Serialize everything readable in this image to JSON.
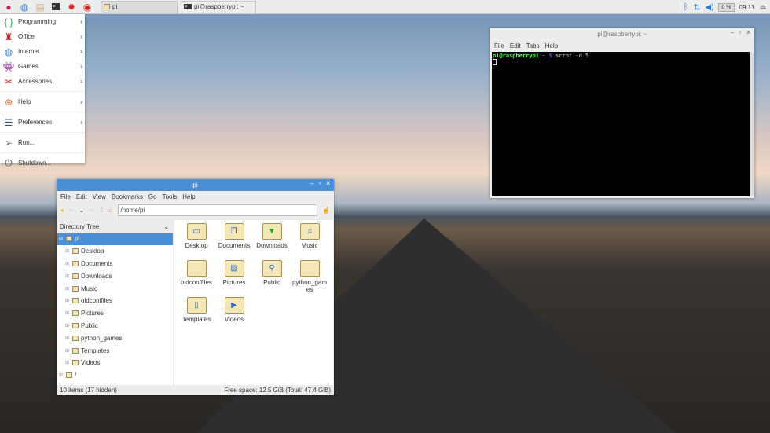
{
  "taskbar": {
    "launchers": [
      "raspberry-icon",
      "globe-icon",
      "folders-icon",
      "terminal-icon",
      "mathematica-icon",
      "wolfram-icon"
    ],
    "tasks": [
      {
        "label": "pi",
        "icon": "folder-icon"
      },
      {
        "label": "pi@raspberrypi: ~",
        "icon": "terminal-icon"
      }
    ],
    "tray": {
      "cpu": "0 %",
      "clock": "09:13"
    }
  },
  "menu": {
    "items": [
      {
        "label": "Programming",
        "icon": "programming-icon",
        "submenu": true
      },
      {
        "label": "Office",
        "icon": "office-icon",
        "submenu": true
      },
      {
        "label": "Internet",
        "icon": "globe-icon",
        "submenu": true
      },
      {
        "label": "Games",
        "icon": "games-icon",
        "submenu": true
      },
      {
        "label": "Accessories",
        "icon": "accessories-icon",
        "submenu": true
      },
      {
        "label": "Help",
        "icon": "help-icon",
        "submenu": true
      },
      {
        "label": "Preferences",
        "icon": "preferences-icon",
        "submenu": true
      },
      {
        "label": "Run...",
        "icon": "run-icon",
        "submenu": false
      },
      {
        "label": "Shutdown...",
        "icon": "power-icon",
        "submenu": false
      }
    ]
  },
  "filemanager": {
    "title": "pi",
    "menu": [
      "File",
      "Edit",
      "View",
      "Bookmarks",
      "Go",
      "Tools",
      "Help"
    ],
    "path": "/home/pi",
    "tree_header": "Directory Tree",
    "tree_root": "pi",
    "tree": [
      "Desktop",
      "Documents",
      "Downloads",
      "Music",
      "oldconffiles",
      "Pictures",
      "Public",
      "python_games",
      "Templates",
      "Videos"
    ],
    "tree_fs_root": "/",
    "items": [
      "Desktop",
      "Documents",
      "Downloads",
      "Music",
      "oldconffiles",
      "Pictures",
      "Public",
      "python_games",
      "Templates",
      "Videos"
    ],
    "status_left": "10 items (17 hidden)",
    "status_right": "Free space: 12.5 GiB (Total: 47.4 GiB)",
    "accent": "#4a90d9"
  },
  "terminal": {
    "title": "pi@raspberrypi: ~",
    "menu": [
      "File",
      "Edit",
      "Tabs",
      "Help"
    ],
    "prompt_user": "pi@raspberrypi",
    "prompt_path": ":~ $",
    "command": " scrot -d 5"
  }
}
